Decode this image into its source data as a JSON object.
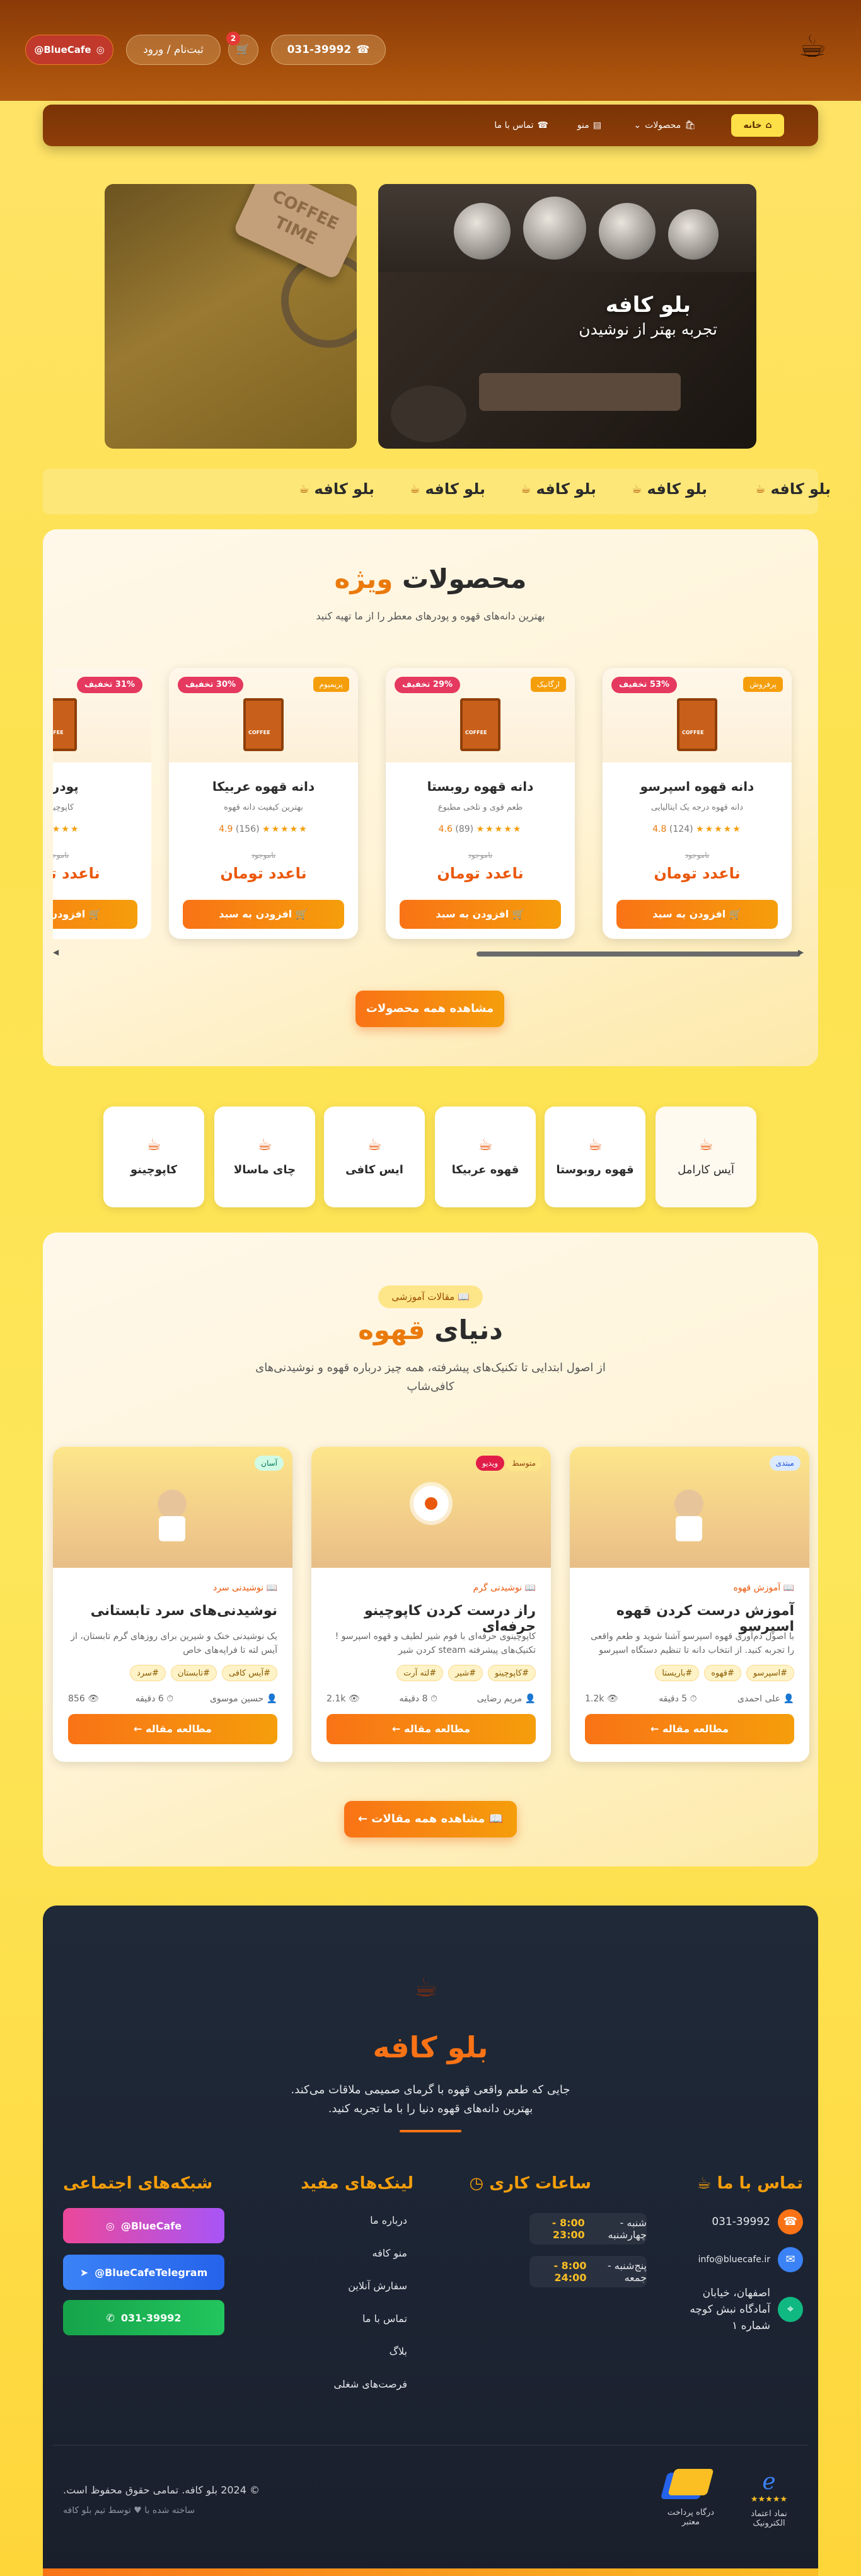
{
  "header": {
    "phone": "031-39992",
    "cart_count": "2",
    "login": "ثبت‌نام / ورود",
    "instagram": "BlueCafe@"
  },
  "nav": {
    "home": "خانه",
    "products": "محصولات",
    "menu": "منو",
    "contact": "تماس با ما"
  },
  "hero": {
    "title": "بلو کافه",
    "subtitle": "تجربه بهتر از نوشیدن",
    "sign_text": "COFFEE TIME"
  },
  "marquee": [
    "بلو کافه",
    "بلو کافه",
    "بلو کافه",
    "بلو کافه",
    "بلو کافه"
  ],
  "featured": {
    "title_a": "محصولات",
    "title_b": "ویژه",
    "subtitle": "بهترین دانه‌های قهوه و پودرهای معطر را از ما تهیه کنید",
    "add_label": "افزودن به سبد",
    "unavailable": "ناموجود",
    "price": "ناعدد تومان",
    "products": [
      {
        "name": "دانه قهوه اسپرسو",
        "desc": "دانه قهوه درجه یک ایتالیایی",
        "rating": "4.8",
        "reviews": "(124)",
        "discount": "53% تخفیف",
        "tag": "پرفروش"
      },
      {
        "name": "دانه قهوه روبستا",
        "desc": "طعم قوی و تلخی مطبوع",
        "rating": "4.6",
        "reviews": "(89)",
        "discount": "29% تخفیف",
        "tag": "ارگانیک"
      },
      {
        "name": "دانه قهوه عربیکا",
        "desc": "بهترین کیفیت دانه قهوه",
        "rating": "4.9",
        "reviews": "(156)",
        "discount": "30% تخفیف",
        "tag": "پریمیوم"
      },
      {
        "name": "پودر ک",
        "desc": "کاپوچینو ه",
        "rating": "",
        "reviews": "",
        "discount": "31% تخفیف",
        "tag": ""
      }
    ],
    "view_all": "مشاهده همه محصولات"
  },
  "categories": [
    "آیس کارامل",
    "قهوه روبوستا",
    "قهوه عربیکا",
    "ایس کافی",
    "چای ماسالا",
    "کاپوچینو"
  ],
  "articles": {
    "chip": "مقالات آموزشی",
    "title_a": "دنیای",
    "title_b": "قهوه",
    "subtitle": "از اصول ابتدایی تا تکنیک‌های پیشرفته، همه چیز درباره قهوه و نوشیدنی‌های کافی‌شاپ",
    "read_label": "مطالعه مقاله",
    "items": [
      {
        "category": "آموزش قهوه",
        "title": "آموزش درست کردن قهوه اسپرسو",
        "desc": "با اصول دم‌آوری قهوه اسپرسو آشنا شوید و طعم واقعی را تجربه کنید. از انتخاب دانه تا تنظیم دستگاه اسپرسو",
        "tags": [
          "#اسپرسو",
          "#قهوه",
          "#باریستا"
        ],
        "author": "علی احمدی",
        "time": "5 دقیقه",
        "views": "1.2k",
        "level": "مبتدی",
        "video": ""
      },
      {
        "category": "نوشیدنی گرم",
        "title": "راز درست کردن کاپوچینو حرفه‌ای",
        "desc": "کاپوچینوی حرفه‌ای با فوم شیر لطیف و قهوه اسپرسو ! تکنیک‌های پیشرفته steam کردن شیر",
        "tags": [
          "#کاپوچینو",
          "#شیر",
          "#لته آرت"
        ],
        "author": "مریم رضایی",
        "time": "8 دقیقه",
        "views": "2.1k",
        "level": "متوسط",
        "video": "ویدیو"
      },
      {
        "category": "نوشیدنی سرد",
        "title": "نوشیدنی‌های سرد تابستانی",
        "desc": "یک نوشیدنی خنک و شیرین برای روزهای گرم تابستان، از آیس لته تا فراپه‌های خاص",
        "tags": [
          "#آیس کافی",
          "#تابستان",
          "#سرد"
        ],
        "author": "حسین موسوی",
        "time": "6 دقیقه",
        "views": "856",
        "level": "آسان",
        "video": ""
      }
    ],
    "view_all": "مشاهده همه مقالات"
  },
  "footer": {
    "brand": "بلو کافه",
    "desc": "جایی که طعم واقعی قهوه با گرمای صمیمی ملاقات می‌کند. بهترین دانه‌های قهوه دنیا را با ما تجربه کنید.",
    "contact_title": "تماس با ما",
    "phone": "031-39992",
    "email": "info@bluecafe.ir",
    "address": "اصفهان، خیابان آمادگاه نبش کوچه شماره ۱",
    "hours_title": "ساعات کاری",
    "hours": [
      {
        "days": "شنبه - چهارشنبه",
        "time": "8:00 - 23:00"
      },
      {
        "days": "پنج‌شنبه - جمعه",
        "time": "8:00 - 24:00"
      }
    ],
    "links_title": "لینک‌های مفید",
    "links": [
      "درباره ما",
      "منو کافه",
      "سفارش آنلاین",
      "تماس با ما",
      "بلاگ",
      "فرصت‌های شغلی"
    ],
    "social_title": "شبکه‌های اجتماعی",
    "social": [
      "BlueCafe@",
      "BlueCafeTelegram@",
      "031-39992"
    ],
    "copyright": "© 2024 بلو کافه. تمامی حقوق محفوظ است.",
    "made_by": "ساخته شده با ♥ توسط تیم بلو کافه",
    "trust1": "نماد اعتماد الکترونیک",
    "trust2": "درگاه پرداخت معتبر",
    "stars": "★★★★★"
  }
}
